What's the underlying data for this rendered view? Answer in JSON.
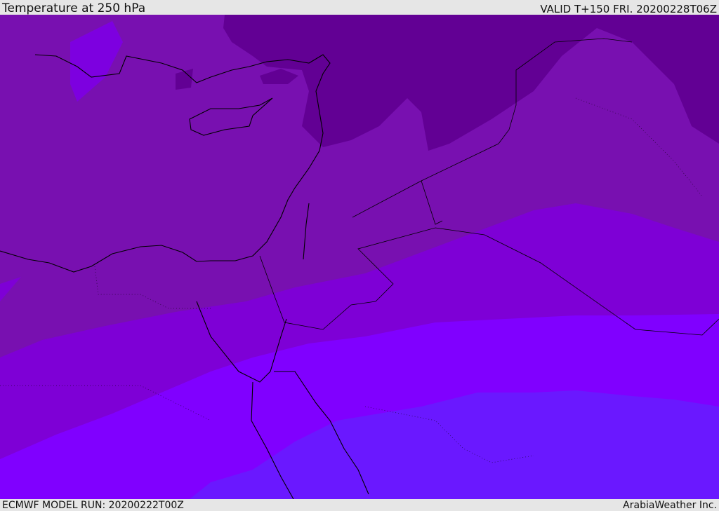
{
  "header": {
    "title": "Temperature at 250 hPa",
    "valid": "VALID T+150 FRI. 20200228T06Z"
  },
  "footer": {
    "model_run": "ECMWF MODEL RUN: 20200222T00Z",
    "credit": "ArabiaWeather Inc."
  },
  "colors": {
    "band_coldest": "#620094",
    "band_cold": "#7810b0",
    "band_mid": "#7e00d6",
    "band_warm": "#8000ff",
    "band_warmest": "#6a18ff",
    "coastline": "#000000"
  }
}
